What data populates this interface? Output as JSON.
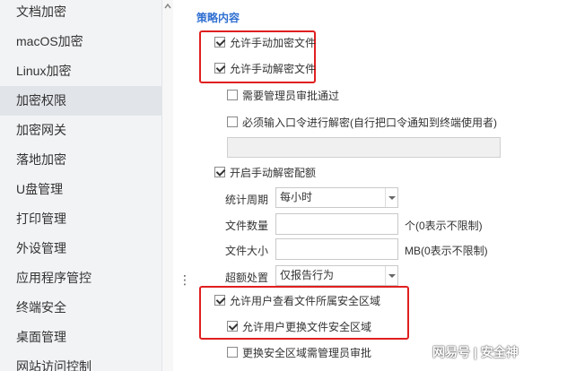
{
  "sidebar": {
    "items": [
      {
        "label": "文档加密"
      },
      {
        "label": "macOS加密"
      },
      {
        "label": "Linux加密"
      },
      {
        "label": "加密权限"
      },
      {
        "label": "加密网关"
      },
      {
        "label": "落地加密"
      },
      {
        "label": "U盘管理"
      },
      {
        "label": "打印管理"
      },
      {
        "label": "外设管理"
      },
      {
        "label": "应用程序管控"
      },
      {
        "label": "终端安全"
      },
      {
        "label": "桌面管理"
      },
      {
        "label": "网站访问控制"
      }
    ],
    "active_index": 3
  },
  "main": {
    "section_title": "策略内容",
    "options": {
      "allow_manual_encrypt": {
        "label": "允许手动加密文件",
        "checked": true
      },
      "allow_manual_decrypt": {
        "label": "允许手动解密文件",
        "checked": true
      },
      "require_admin_approval": {
        "label": "需要管理员审批通过",
        "checked": false
      },
      "require_password": {
        "label": "必须输入口令进行解密(自行把口令通知到终端使用者)",
        "checked": false
      },
      "password_value": "",
      "enable_quota": {
        "label": "开启手动解密配额",
        "checked": true
      }
    },
    "quota": {
      "period_label": "统计周期",
      "period_value": "每小时",
      "count_label": "文件数量",
      "count_value": "",
      "count_hint": "个(0表示不限制)",
      "size_label": "文件大小",
      "size_value": "",
      "size_hint": "MB(0表示不限制)",
      "overflow_label": "超额处置",
      "overflow_value": "仅报告行为"
    },
    "security_zone": {
      "view_zone": {
        "label": "允许用户查看文件所属安全区域",
        "checked": true
      },
      "change_zone": {
        "label": "允许用户更换文件安全区域",
        "checked": true
      },
      "change_zone_approval": {
        "label": "更换安全区域需管理员审批",
        "checked": false
      }
    }
  },
  "watermark": "网易号 | 安全神",
  "colors": {
    "highlight_box": "#e01f1f",
    "section_title": "#2f6fd1",
    "sidebar_bg": "#f2f3f5",
    "sidebar_active": "#e1e4e9"
  }
}
